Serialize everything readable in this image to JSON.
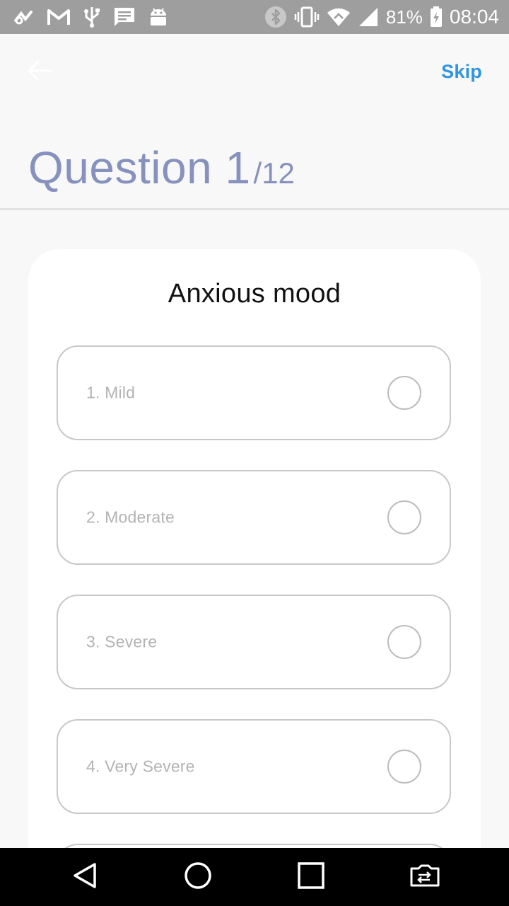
{
  "status_bar": {
    "left_icons": [
      "link-icon",
      "gmail-icon",
      "usb-icon",
      "message-icon",
      "android-icon"
    ],
    "right_icons": [
      "bluetooth-icon",
      "vibrate-icon",
      "wifi-icon",
      "signal-icon"
    ],
    "battery_percent": "81%",
    "time": "08:04"
  },
  "app_bar": {
    "back_icon": "arrow-left-icon",
    "skip_label": "Skip"
  },
  "question": {
    "current": "Question 1",
    "total": "/12"
  },
  "card": {
    "title": "Anxious mood",
    "options": [
      {
        "label": "1. Mild",
        "selected": false
      },
      {
        "label": "2. Moderate",
        "selected": false
      },
      {
        "label": "3. Severe",
        "selected": false
      },
      {
        "label": "4. Very Severe",
        "selected": false
      }
    ]
  },
  "nav_bar": {
    "buttons": [
      "back-triangle-icon",
      "home-circle-icon",
      "recents-square-icon",
      "switch-app-icon"
    ]
  },
  "colors": {
    "status_bar_bg": "#9e9e9e",
    "accent": "#2f95e0",
    "question_heading": "#8692bd",
    "option_border": "#c8c8c8",
    "option_text": "#b3b3b3"
  }
}
